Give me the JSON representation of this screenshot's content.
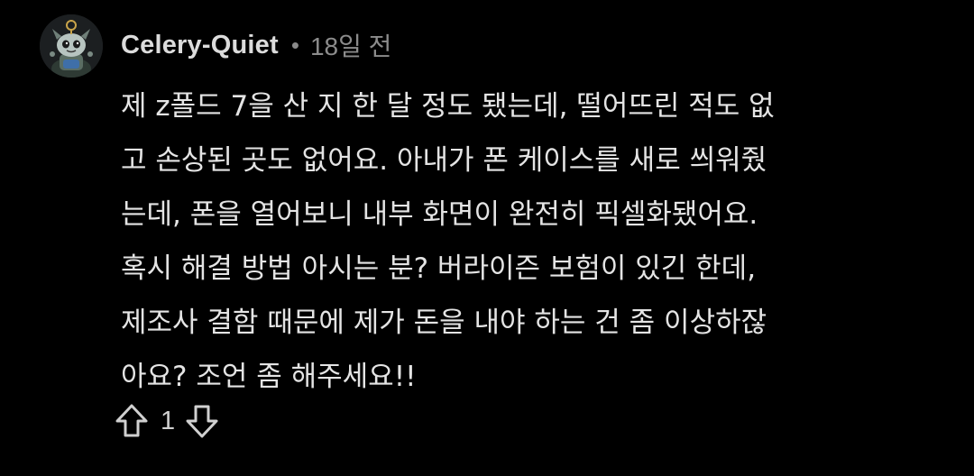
{
  "comment": {
    "author": "Celery-Quiet",
    "separator": "•",
    "time": "18일 전",
    "lines": [
      "제 z폴드 7을 산 지 한 달 정도 됐는데, 떨어뜨린 적도 없",
      "고 손상된 곳도 없어요. 아내가 폰 케이스를 새로 씌워줬",
      "는데, 폰을 열어보니 내부 화면이 완전히 픽셀화됐어요.",
      "혹시 해결 방법 아시는 분? 버라이즌 보험이 있긴 한데,",
      "제조사 결함 때문에 제가 돈을 내야 하는 건 좀 이상하잖",
      "아요? 조언 좀 해주세요!!"
    ],
    "vote_count": "1",
    "icons": {
      "upvote": "arrow-up-outline-icon",
      "downvote": "arrow-down-outline-icon",
      "avatar": "user-avatar"
    }
  },
  "colors": {
    "background": "#000000",
    "text": "#e4e4e4",
    "muted": "#8c8c8c"
  }
}
